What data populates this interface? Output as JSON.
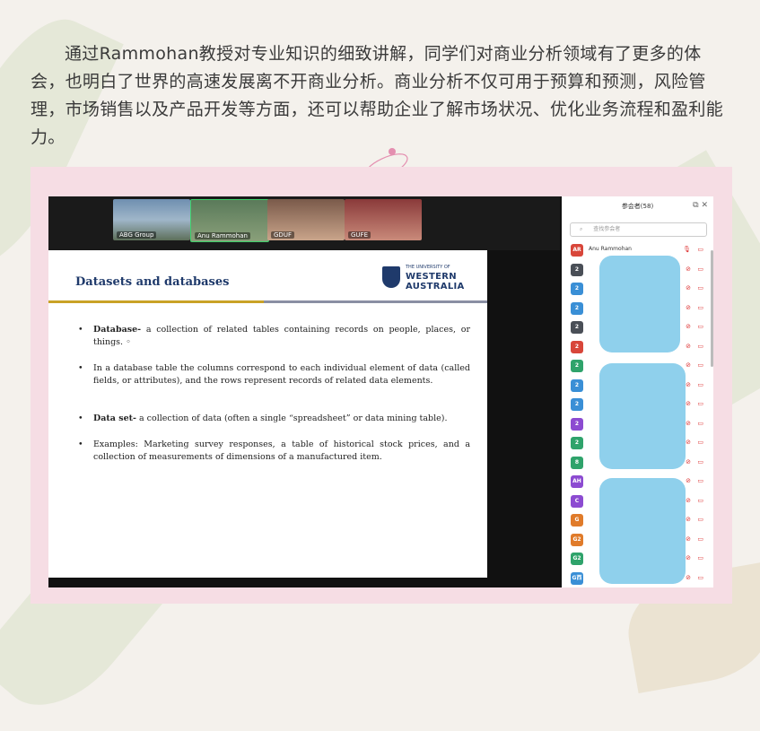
{
  "intro_text": "通过Rammohan教授对专业知识的细致讲解，同学们对商业分析领域有了更多的体会，也明白了世界的高速发展离不开商业分析。商业分析不仅可用于预算和预测，风险管理，市场销售以及产品开发等方面，还可以帮助企业了解市场状况、优化业务流程和盈利能力。",
  "video_tiles": [
    {
      "name": "ABG Group"
    },
    {
      "name": "Anu Rammohan"
    },
    {
      "name": "GDUF"
    },
    {
      "name": "GUFE"
    }
  ],
  "slide": {
    "title": "Datasets and databases",
    "logo_line1": "THE UNIVERSITY OF",
    "logo_line2": "WESTERN",
    "logo_line3": "AUSTRALIA",
    "bullets": [
      {
        "term": "Database-",
        "text": " a collection of related tables containing records on people, places, or things. ◦"
      },
      {
        "term": "",
        "text": "In a database table the columns correspond to each individual element of data (called fields, or attributes), and the rows represent records of related data elements."
      },
      {
        "term": "Data set-",
        "text": " a collection of data (often a single “spreadsheet” or data mining table)."
      },
      {
        "term": "",
        "text": "Examples: Marketing survey responses, a table of historical stock prices, and a collection of measurements of dimensions of a manufactured item."
      }
    ]
  },
  "participants_panel": {
    "title": "参会者(58)",
    "search_placeholder": "查找参会者",
    "host_initials": "AR",
    "host_name": "Anu Rammohan",
    "rows": [
      {
        "initials": "AR",
        "color": "#d8463a"
      },
      {
        "initials": "2",
        "color": "#4a4f57"
      },
      {
        "initials": "2",
        "color": "#3a8fd6"
      },
      {
        "initials": "2",
        "color": "#3a8fd6"
      },
      {
        "initials": "2",
        "color": "#4a4f57"
      },
      {
        "initials": "2",
        "color": "#d8463a"
      },
      {
        "initials": "2",
        "color": "#2fa36b"
      },
      {
        "initials": "2",
        "color": "#3a8fd6"
      },
      {
        "initials": "2",
        "color": "#3a8fd6"
      },
      {
        "initials": "2",
        "color": "#8c4bd1"
      },
      {
        "initials": "2",
        "color": "#2fa36b"
      },
      {
        "initials": "8",
        "color": "#2fa36b"
      },
      {
        "initials": "AH",
        "color": "#8c4bd1"
      },
      {
        "initials": "C",
        "color": "#8c4bd1"
      },
      {
        "initials": "G",
        "color": "#e07b2a"
      },
      {
        "initials": "G2",
        "color": "#e07b2a"
      },
      {
        "initials": "G2",
        "color": "#2fa36b"
      },
      {
        "initials": "G西",
        "color": "#3a8fd6"
      }
    ]
  },
  "colors": {
    "accent_pink": "#f6dde4",
    "slide_title": "#1f3a6b",
    "rule_gold": "#c9a227"
  }
}
